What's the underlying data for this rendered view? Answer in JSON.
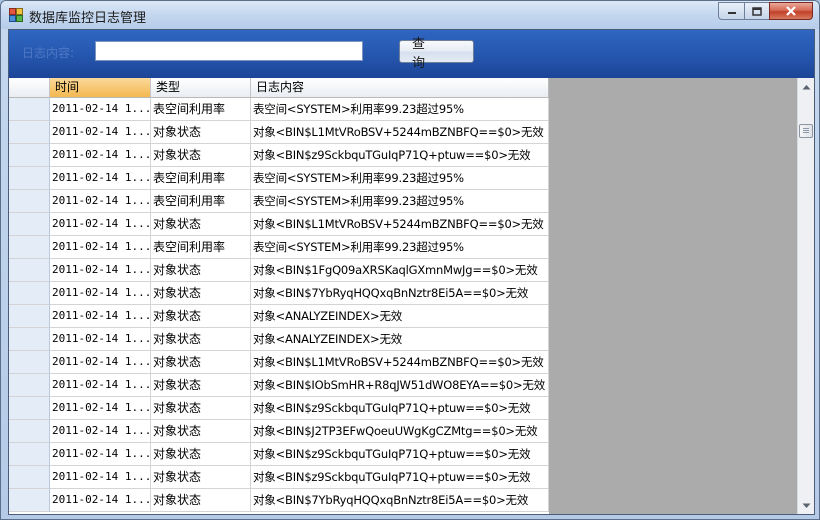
{
  "window": {
    "title": "数据库监控日志管理"
  },
  "toolbar": {
    "log_label": "日志内容:",
    "search_value": "",
    "query_label": "查 询"
  },
  "grid": {
    "columns": [
      "时间",
      "类型",
      "日志内容"
    ],
    "rows": [
      {
        "time": "2011-02-14 1...",
        "type": "表空间利用率",
        "content": "表空间<SYSTEM>利用率99.23超过95%"
      },
      {
        "time": "2011-02-14 1...",
        "type": "对象状态",
        "content": "对象<BIN$L1MtVRoBSV+5244mBZNBFQ==$0>无效"
      },
      {
        "time": "2011-02-14 1...",
        "type": "对象状态",
        "content": "对象<BIN$z9SckbquTGuIqP71Q+ptuw==$0>无效"
      },
      {
        "time": "2011-02-14 1...",
        "type": "表空间利用率",
        "content": "表空间<SYSTEM>利用率99.23超过95%"
      },
      {
        "time": "2011-02-14 1...",
        "type": "表空间利用率",
        "content": "表空间<SYSTEM>利用率99.23超过95%"
      },
      {
        "time": "2011-02-14 1...",
        "type": "对象状态",
        "content": "对象<BIN$L1MtVRoBSV+5244mBZNBFQ==$0>无效"
      },
      {
        "time": "2011-02-14 1...",
        "type": "表空间利用率",
        "content": "表空间<SYSTEM>利用率99.23超过95%"
      },
      {
        "time": "2011-02-14 1...",
        "type": "对象状态",
        "content": "对象<BIN$1FgQ09aXRSKaqlGXmnMwJg==$0>无效"
      },
      {
        "time": "2011-02-14 1...",
        "type": "对象状态",
        "content": "对象<BIN$7YbRyqHQQxqBnNztr8Ei5A==$0>无效"
      },
      {
        "time": "2011-02-14 1...",
        "type": "对象状态",
        "content": "对象<ANALYZEINDEX>无效"
      },
      {
        "time": "2011-02-14 1...",
        "type": "对象状态",
        "content": "对象<ANALYZEINDEX>无效"
      },
      {
        "time": "2011-02-14 1...",
        "type": "对象状态",
        "content": "对象<BIN$L1MtVRoBSV+5244mBZNBFQ==$0>无效"
      },
      {
        "time": "2011-02-14 1...",
        "type": "对象状态",
        "content": "对象<BIN$IObSmHR+R8qJW51dWO8EYA==$0>无效"
      },
      {
        "time": "2011-02-14 1...",
        "type": "对象状态",
        "content": "对象<BIN$z9SckbquTGuIqP71Q+ptuw==$0>无效"
      },
      {
        "time": "2011-02-14 1...",
        "type": "对象状态",
        "content": "对象<BIN$J2TP3EFwQoeuUWgKgCZMtg==$0>无效"
      },
      {
        "time": "2011-02-14 1...",
        "type": "对象状态",
        "content": "对象<BIN$z9SckbquTGuIqP71Q+ptuw==$0>无效"
      },
      {
        "time": "2011-02-14 1...",
        "type": "对象状态",
        "content": "对象<BIN$z9SckbquTGuIqP71Q+ptuw==$0>无效"
      },
      {
        "time": "2011-02-14 1...",
        "type": "对象状态",
        "content": "对象<BIN$7YbRyqHQQxqBnNztr8Ei5A==$0>无效"
      }
    ]
  },
  "icons": {
    "app": "database-app-icon",
    "minimize": "minimize-icon",
    "maximize": "maximize-icon",
    "close": "close-icon",
    "scroll_up": "scroll-up-arrow-icon",
    "scroll_down": "scroll-down-arrow-icon"
  },
  "colors": {
    "toolbar": "#2556ad",
    "selected_header": "#f3b851",
    "row_header": "#e3ecf7",
    "empty_area": "#ababab"
  }
}
